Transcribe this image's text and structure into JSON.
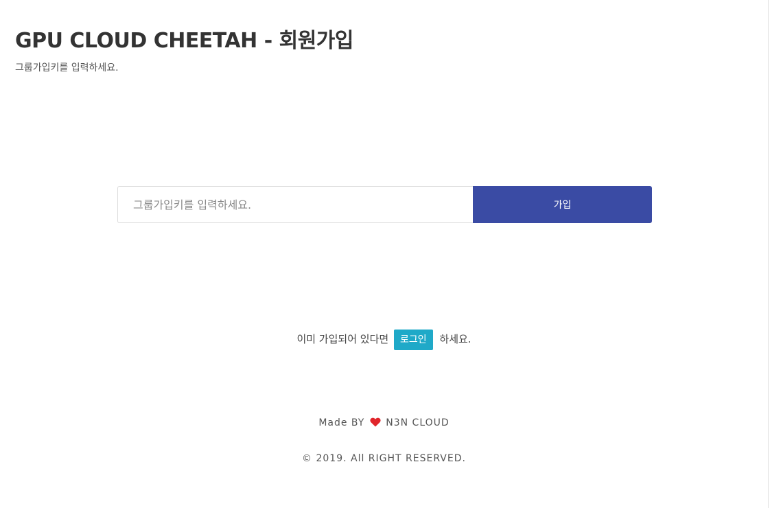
{
  "header": {
    "title": "GPU CLOUD CHEETAH - 회원가입",
    "subtitle": "그룹가입키를 입력하세요."
  },
  "join_form": {
    "group_key_placeholder": "그룹가입키를 입력하세요.",
    "group_key_value": "",
    "submit_label": "가입"
  },
  "login_prompt": {
    "before": "이미 가입되어 있다면",
    "link_label": "로그인",
    "after": "하세요."
  },
  "footer": {
    "made_by_prefix": "Made BY",
    "made_by_icon": "heart-icon",
    "made_by_suffix": "N3N CLOUD",
    "copyright": "© 2019. All RIGHT RESERVED."
  },
  "colors": {
    "primary_button": "#3a4ba4",
    "login_badge": "#1fa9c8",
    "heart": "#e0252b"
  }
}
